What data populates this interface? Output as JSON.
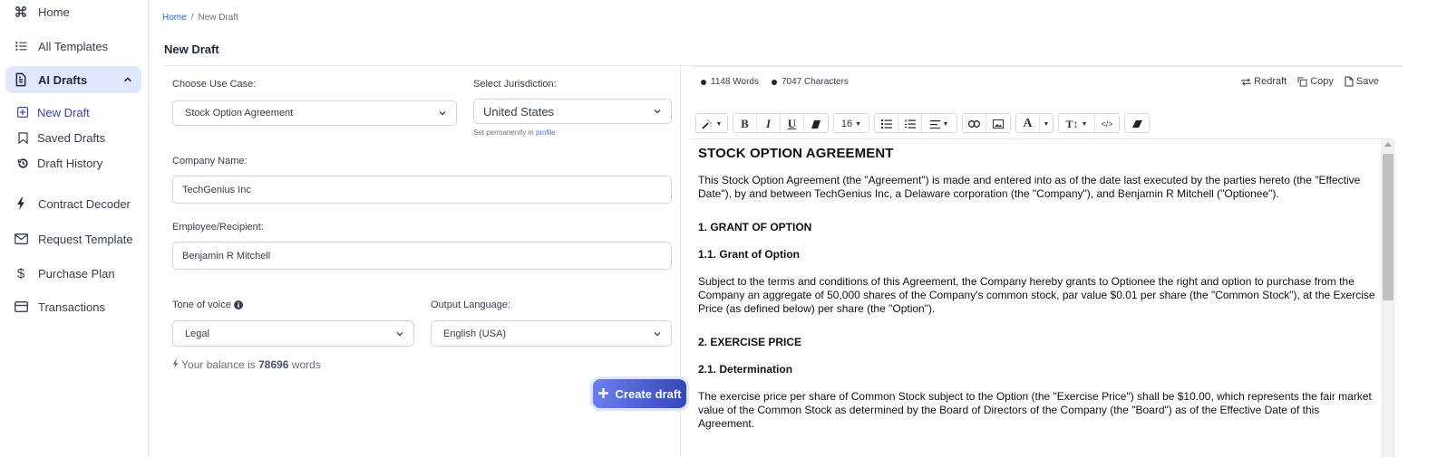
{
  "sidebar": {
    "items": [
      {
        "label": "Home",
        "icon": "command-icon"
      },
      {
        "label": "All Templates",
        "icon": "list-icon"
      },
      {
        "label": "AI Drafts",
        "icon": "document-icon",
        "expanded": true,
        "active": true
      },
      {
        "label": "Contract Decoder",
        "icon": "bolt-icon"
      },
      {
        "label": "Request Template",
        "icon": "mail-icon"
      },
      {
        "label": "Purchase Plan",
        "icon": "dollar-icon"
      },
      {
        "label": "Transactions",
        "icon": "credit-card-icon"
      }
    ],
    "sub_items": [
      {
        "label": "New Draft",
        "icon": "plus-square-icon",
        "current": true
      },
      {
        "label": "Saved Drafts",
        "icon": "bookmark-icon"
      },
      {
        "label": "Draft History",
        "icon": "history-icon"
      }
    ]
  },
  "breadcrumb": {
    "home": "Home",
    "separator": "/",
    "current": "New Draft"
  },
  "page_title": "New Draft",
  "form": {
    "use_case": {
      "label": "Choose Use Case:",
      "value": "Stock Option Agreement"
    },
    "jurisdiction": {
      "label": "Select Jurisdiction:",
      "value": "United States",
      "hint_prefix": "Set permanently in",
      "hint_link": "profile"
    },
    "company": {
      "label": "Company Name:",
      "value": "TechGenius Inc"
    },
    "recipient": {
      "label": "Employee/Recipient:",
      "value": "Benjamin R Mitchell"
    },
    "tone": {
      "label": "Tone of voice",
      "value": "Legal"
    },
    "language": {
      "label": "Output Language:",
      "value": "English (USA)"
    },
    "balance": {
      "prefix": "Your balance is",
      "amount": "78696",
      "suffix": "words"
    },
    "create_label": "Create draft"
  },
  "editor": {
    "words": "1148 Words",
    "characters": "7047 Characters",
    "actions": {
      "redraft": "Redraft",
      "copy": "Copy",
      "save": "Save"
    },
    "font_size": "16",
    "colors": {
      "accent": "#3346b8",
      "active_nav": "#e0e7ff"
    },
    "document": {
      "title": "STOCK OPTION AGREEMENT",
      "intro": "This Stock Option Agreement (the \"Agreement\") is made and entered into as of the date last executed by the parties hereto (the \"Effective Date\"), by and between TechGenius Inc, a Delaware corporation (the \"Company\"), and Benjamin R Mitchell (\"Optionee\").",
      "s1_heading": "1. GRANT OF OPTION",
      "s1_1_heading": "1.1. Grant of Option",
      "s1_1_text": "Subject to the terms and conditions of this Agreement, the Company hereby grants to Optionee the right and option to purchase from the Company an aggregate of 50,000 shares of the Company's common stock, par value $0.01 per share (the \"Common Stock\"), at the Exercise Price (as defined below) per share (the \"Option\").",
      "s2_heading": "2. EXERCISE PRICE",
      "s2_1_heading": "2.1. Determination",
      "s2_1_text": "The exercise price per share of Common Stock subject to the Option (the \"Exercise Price\") shall be $10.00, which represents the fair market value of the Common Stock as determined by the Board of Directors of the Company (the \"Board\") as of the Effective Date of this Agreement."
    }
  }
}
